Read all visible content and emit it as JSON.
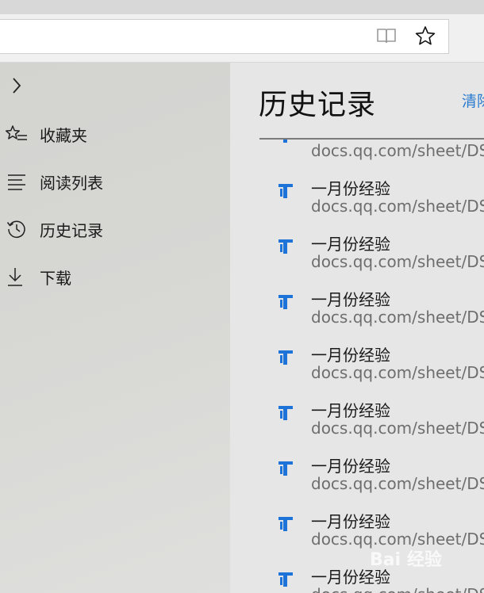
{
  "sidebar": {
    "items": [
      {
        "label": "收藏夹",
        "icon": "star-list-icon"
      },
      {
        "label": "阅读列表",
        "icon": "reading-list-icon"
      },
      {
        "label": "历史记录",
        "icon": "history-clock-icon"
      },
      {
        "label": "下载",
        "icon": "download-icon"
      }
    ]
  },
  "panel": {
    "title": "历史记录",
    "clear_label": "清除"
  },
  "history": {
    "partial": {
      "url": "docs.qq.com/sheet/DSWF"
    },
    "items": [
      {
        "title": "一月份经验",
        "url": "docs.qq.com/sheet/DSWF"
      },
      {
        "title": "一月份经验",
        "url": "docs.qq.com/sheet/DSWF"
      },
      {
        "title": "一月份经验",
        "url": "docs.qq.com/sheet/DSWF"
      },
      {
        "title": "一月份经验",
        "url": "docs.qq.com/sheet/DSWF"
      },
      {
        "title": "一月份经验",
        "url": "docs.qq.com/sheet/DSWF"
      },
      {
        "title": "一月份经验",
        "url": "docs.qq.com/sheet/DSWF"
      },
      {
        "title": "一月份经验",
        "url": "docs.qq.com/sheet/DSWF"
      },
      {
        "title": "一月份经验",
        "url": "docs.qq.com/sheet/DSWF"
      }
    ]
  },
  "watermark": "Bai 经验",
  "colors": {
    "accent": "#2a7ad0",
    "favicon": "#1e73d8"
  }
}
